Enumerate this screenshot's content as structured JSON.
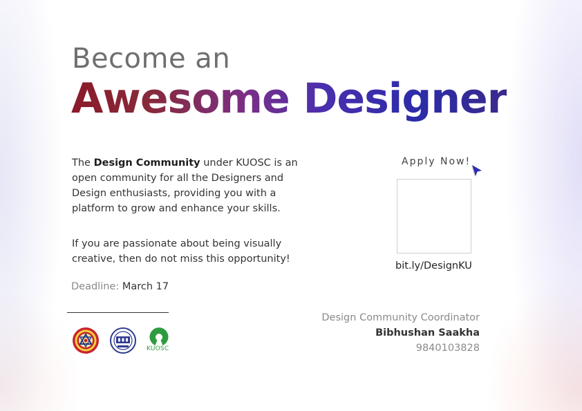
{
  "heading": {
    "line1": "Become an",
    "line2": "Awesome Designer"
  },
  "intro": {
    "pre": "The ",
    "strong": "Design Community",
    "rest": " under KUOSC is an open community for all the Designers and Design enthusiasts, providing you with a platform to grow and enhance your skills."
  },
  "second_paragraph": "If you are passionate about being visually creative, then do not miss this opportunity!",
  "deadline": {
    "label": "Deadline:",
    "value": "March 17"
  },
  "apply": {
    "label": "Apply Now!",
    "link": "bit.ly/DesignKU"
  },
  "coordinator": {
    "title": "Design Community Coordinator",
    "name": "Bibhushan Saakha",
    "phone": "9840103828"
  },
  "logos": {
    "kuosc_text": "KUOSC",
    "ku_logo_icon": "ku-emblem-icon",
    "kucc_logo_icon": "kucc-emblem-icon",
    "kuosc_logo_icon": "open-source-icon"
  },
  "colors": {
    "gradient_start": "#8a1a2a",
    "gradient_mid": "#7a2f86",
    "gradient_end": "#2c2ca8",
    "cursor": "#2b2fb0",
    "kuosc_green": "#2e9b3f"
  }
}
